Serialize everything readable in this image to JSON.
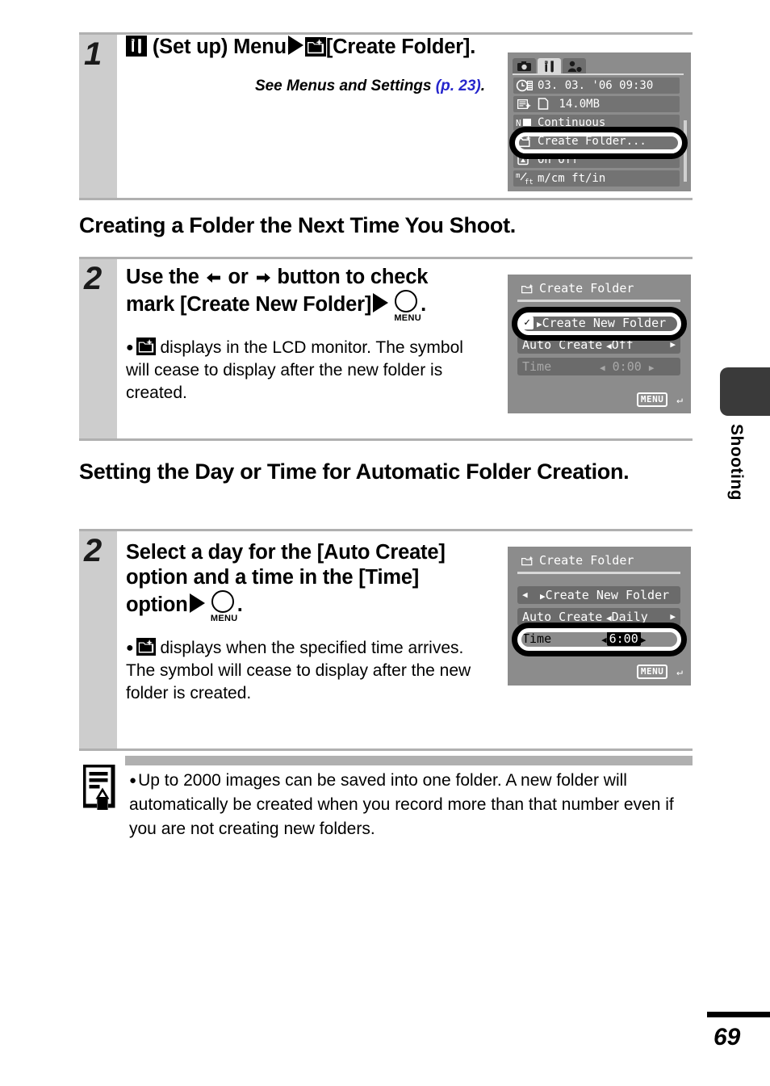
{
  "page": {
    "number": "69",
    "side_tab_label": "Shooting"
  },
  "steps": [
    {
      "number": "1",
      "heading_parts": {
        "icon_setup": "setup-tools-icon",
        "text_a": "(Set up) Menu",
        "arrow": "solid-right-triangle",
        "icon_folder": "create-folder-icon",
        "text_b": "[Create Folder]."
      },
      "see_also": {
        "text": "See Menus and Settings ",
        "ref": "(p. 23)",
        "tail": "."
      }
    },
    {
      "number": "2",
      "heading_parts": {
        "t1": "Use the",
        "t2": "or",
        "t3": "button to check mark [Create New Folder]",
        "menu_label": "MENU"
      },
      "bullet": " displays in the LCD monitor. The symbol will cease to display after the new folder is created."
    },
    {
      "number": "2",
      "heading_parts": {
        "t1": "Select a day for the [Auto Create] option and a time in the [Time] option",
        "menu_label": "MENU"
      },
      "bullet": " displays when the specified time arrives. The symbol will cease to display after the new folder is created."
    }
  ],
  "section_headings": [
    "Creating a Folder the Next Time You Shoot.",
    "Setting the Day or Time for Automatic Folder Creation."
  ],
  "lcd_setup_menu": {
    "tabs": [
      "camera-icon",
      "setup-tools-icon",
      "my-camera-icon"
    ],
    "rows": [
      {
        "icon": "date-time-icon",
        "text": "03. 03. '06  09:30"
      },
      {
        "icon": "format-card-icon",
        "text": "14.0MB",
        "sub_icon": "card-icon"
      },
      {
        "icon": "file-no-icon",
        "text": "Continuous"
      },
      {
        "icon": "create-folder-icon",
        "text": "Create Folder..."
      },
      {
        "icon": "auto-rotate-icon",
        "text": "On  Off"
      },
      {
        "icon": "units-icon",
        "text": "m/cm  ft/in",
        "icon_label": "m/ft"
      }
    ],
    "highlighted_row_text": "Create Folder..."
  },
  "lcd_create_folder_a": {
    "title": "Create Folder",
    "title_icon": "create-folder-icon",
    "items": [
      {
        "label": "Create New Folder",
        "value": "",
        "checked": true,
        "dim": false
      },
      {
        "label": "Auto Create",
        "value": "Off",
        "dim": false,
        "arrows": true
      },
      {
        "label": "Time",
        "value": "0:00",
        "dim": true,
        "arrows": true
      }
    ],
    "menu_return": "MENU",
    "highlighted_item": "Create New Folder"
  },
  "lcd_create_folder_b": {
    "title": "Create Folder",
    "title_icon": "create-folder-icon",
    "items": [
      {
        "label": "Create New Folder",
        "value": "",
        "checked": false,
        "dim": false,
        "arrows": true
      },
      {
        "label": "Auto Create",
        "value": "Daily",
        "dim": false,
        "arrows": true
      },
      {
        "label": "Time",
        "value": "6:00",
        "dim": false,
        "arrows": true,
        "highlight_value": true
      }
    ],
    "menu_return": "MENU",
    "highlighted_item": "Time"
  },
  "note": {
    "icon": "memo-pencil-icon",
    "text": "Up to 2000 images can be saved into one folder. A new folder will automatically be created when you record more than that number even if you are not creating new folders."
  },
  "colors": {
    "link": "#2626cc",
    "rule": "#b0b0b0",
    "step_col": "#cdcdcd",
    "lcd_bg": "#8c8c8c",
    "side_tab": "#3a3a3a"
  }
}
